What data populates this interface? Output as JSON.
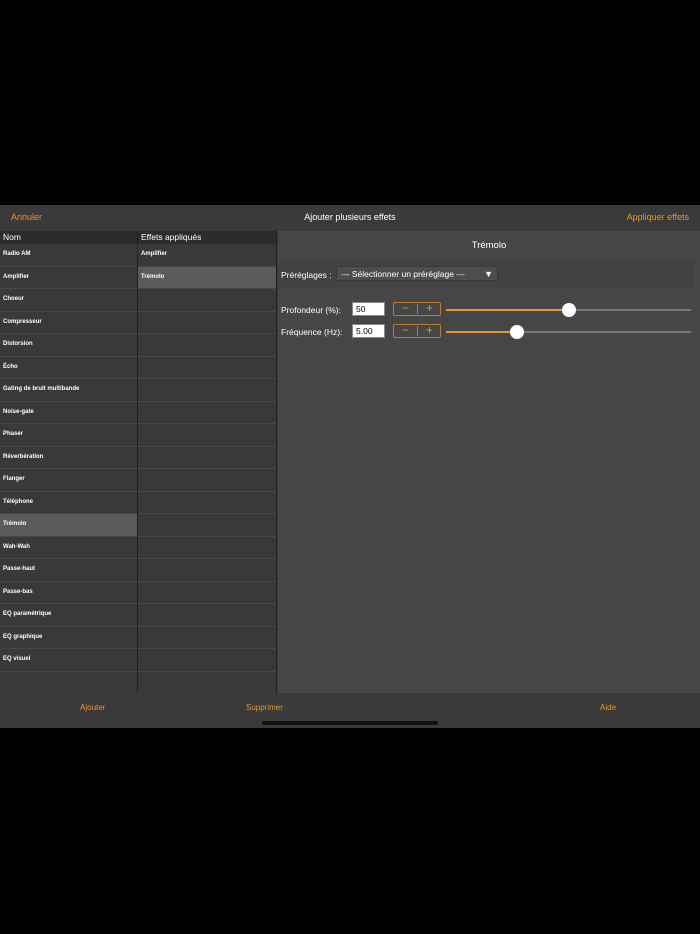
{
  "topbar": {
    "cancel_label": "Annuler",
    "title": "Ajouter plusieurs effets",
    "apply_label": "Appliquer effets"
  },
  "effects_list": {
    "header": "Nom",
    "items": [
      "Radio AM",
      "Amplifier",
      "Choeur",
      "Compresseur",
      "Distorsion",
      "Écho",
      "Gating de bruit multibande",
      "Noise-gate",
      "Phaser",
      "Réverbération",
      "Flanger",
      "Téléphone",
      "Trémolo",
      "Wah-Wah",
      "Passe-haut",
      "Passe-bas",
      "EQ paramétrique",
      "EQ graphique",
      "EQ visuel",
      "",
      ""
    ],
    "selected": "Trémolo"
  },
  "applied_list": {
    "header": "Effets appliqués",
    "items": [
      "Amplifier",
      "Trémolo",
      "",
      "",
      "",
      "",
      "",
      "",
      "",
      "",
      "",
      "",
      "",
      "",
      "",
      "",
      "",
      "",
      "",
      "",
      ""
    ],
    "selected": "Trémolo"
  },
  "panel": {
    "title": "Trémolo",
    "presets_label": "Préréglages :",
    "presets_value": "--- Sélectionner un préréglage ---",
    "params": [
      {
        "label": "Profondeur (%):",
        "value": "50",
        "level": 0.5
      },
      {
        "label": "Fréquence (Hz):",
        "value": "5.00",
        "level": 0.29
      }
    ]
  },
  "bottombar": {
    "add_label": "Ajouter",
    "remove_label": "Supprimer",
    "help_label": "Aide"
  },
  "colors": {
    "accent": "#e8952c",
    "background": "#3a3a3a",
    "selected_row": "#5a5a5a"
  }
}
